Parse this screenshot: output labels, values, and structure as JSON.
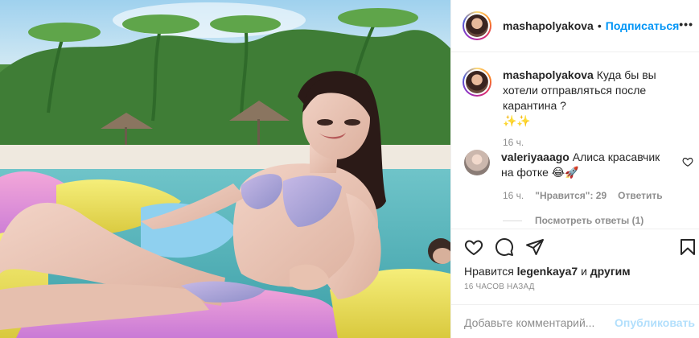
{
  "header": {
    "username": "mashapolyakova",
    "separator": "•",
    "follow_label": "Подписаться",
    "more_glyph": "•••"
  },
  "caption": {
    "username": "mashapolyakova",
    "text": "Куда бы вы хотели отправляться после карантина ?",
    "emoji": "✨✨",
    "time": "16 ч."
  },
  "comment": {
    "username": "valeriyaaago",
    "text": "Алиса красавчик на фотке",
    "emoji": "😂🚀",
    "time": "16 ч.",
    "likes": "\"Нравится\": 29",
    "reply_label": "Ответить",
    "view_replies": "Посмотреть ответы (1)"
  },
  "actions": {
    "icons": [
      "heart-icon",
      "comment-icon",
      "share-icon",
      "save-icon"
    ]
  },
  "likes": {
    "prefix": "Нравится",
    "user": "legenkaya7",
    "conj": "и",
    "others": "другим"
  },
  "timestamp": "16 ЧАСОВ НАЗАД",
  "add_comment": {
    "placeholder": "Добавьте комментарий...",
    "publish_label": "Опубликовать"
  },
  "colors": {
    "accent": "#0095f6",
    "publish_disabled": "#b2dffc",
    "muted": "#8e8e8e"
  }
}
